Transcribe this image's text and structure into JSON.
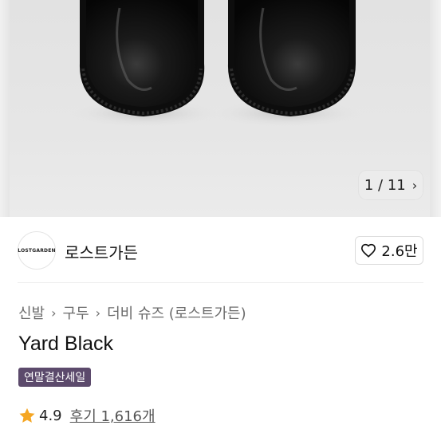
{
  "gallery": {
    "counter_text": "1 / 11",
    "next_glyph": "›"
  },
  "store": {
    "logo_text": "LOSTGARDEN",
    "name": "로스트가든",
    "like_count": "2.6만"
  },
  "breadcrumb": {
    "items": [
      "신발",
      "구두",
      "더비 슈즈 (로스트가든)"
    ],
    "separator": "›"
  },
  "product": {
    "title": "Yard Black",
    "badge": "연말결산세일",
    "rating": "4.9",
    "reviews": "후기 1,616개"
  },
  "colors": {
    "badge_bg": "#5c4a6c",
    "star": "#f5a623"
  },
  "icons": {
    "like": "heart-outline-icon",
    "rating": "star-icon",
    "next": "chevron-right-icon"
  }
}
